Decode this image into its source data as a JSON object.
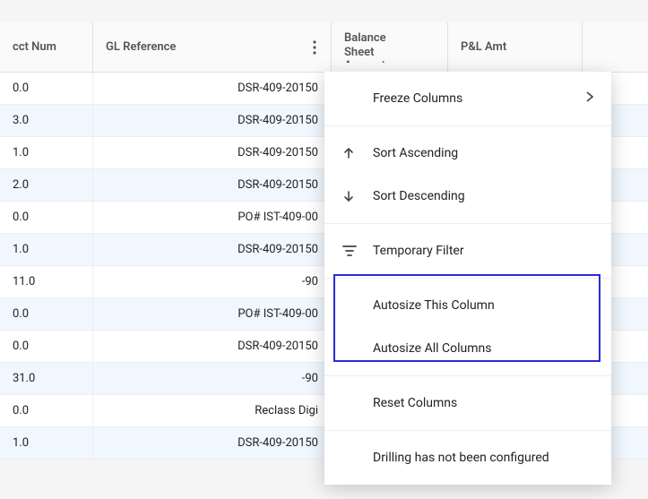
{
  "headers": {
    "acct": "cct Num",
    "gl": "GL Reference",
    "bal_l1": "Balance",
    "bal_l2": "Sheet",
    "bal_l3": "Amount",
    "pl": "P&L Amt"
  },
  "rows": [
    {
      "acct": "0.0",
      "gl": "DSR-409-20150",
      "hl": false
    },
    {
      "acct": "3.0",
      "gl": "DSR-409-20150",
      "hl": true
    },
    {
      "acct": "1.0",
      "gl": "DSR-409-20150",
      "hl": false
    },
    {
      "acct": "2.0",
      "gl": "DSR-409-20150",
      "hl": true
    },
    {
      "acct": "0.0",
      "gl": "PO# IST-409-00",
      "hl": false
    },
    {
      "acct": "1.0",
      "gl": "DSR-409-20150",
      "hl": true
    },
    {
      "acct": "11.0",
      "gl": "-90",
      "hl": false
    },
    {
      "acct": "0.0",
      "gl": "PO# IST-409-00",
      "hl": true
    },
    {
      "acct": "0.0",
      "gl": "DSR-409-20150",
      "hl": false
    },
    {
      "acct": "31.0",
      "gl": "-90",
      "hl": true
    },
    {
      "acct": "0.0",
      "gl": "Reclass Digi",
      "hl": false
    },
    {
      "acct": "1.0",
      "gl": "DSR-409-20150",
      "hl": true
    }
  ],
  "menu": {
    "freeze": "Freeze Columns",
    "sort_asc": "Sort Ascending",
    "sort_desc": "Sort Descending",
    "temp_filter": "Temporary Filter",
    "autosize_this": "Autosize This Column",
    "autosize_all": "Autosize All Columns",
    "reset": "Reset Columns",
    "drill_msg": "Drilling has not been configured"
  }
}
